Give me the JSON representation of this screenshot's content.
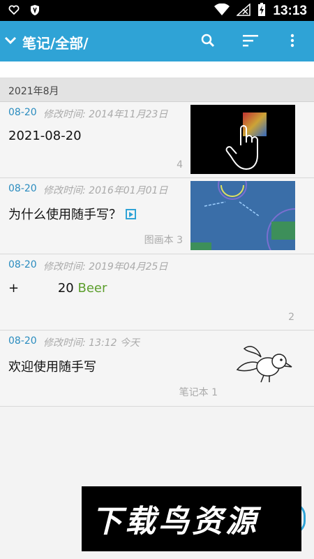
{
  "status_bar": {
    "time": "13:13"
  },
  "app_bar": {
    "title": "笔记/全部/"
  },
  "section": {
    "header": "2021年8月"
  },
  "notes": [
    {
      "date": "08-20",
      "modified": "修改时间: 2014年11月23日",
      "title": "2021-08-20",
      "meta": "4"
    },
    {
      "date": "08-20",
      "modified": "修改时间: 2016年01月01日",
      "title": "为什么使用随手写？",
      "meta": "图画本 3"
    },
    {
      "date": "08-20",
      "modified": "修改时间: 2019年04月25日",
      "title_prefix": "+",
      "title_num": "20",
      "title_beer": "Beer",
      "meta": "2"
    },
    {
      "date": "08-20",
      "modified": "修改时间: 13:12 今天",
      "title": "欢迎使用随手写",
      "meta": "笔记本 1"
    }
  ],
  "watermark": {
    "text": "下载鸟资源"
  },
  "colors": {
    "app_bar": "#2fa3d6",
    "date_blue": "#2a8cbf",
    "beer_green": "#5c9e2c"
  }
}
